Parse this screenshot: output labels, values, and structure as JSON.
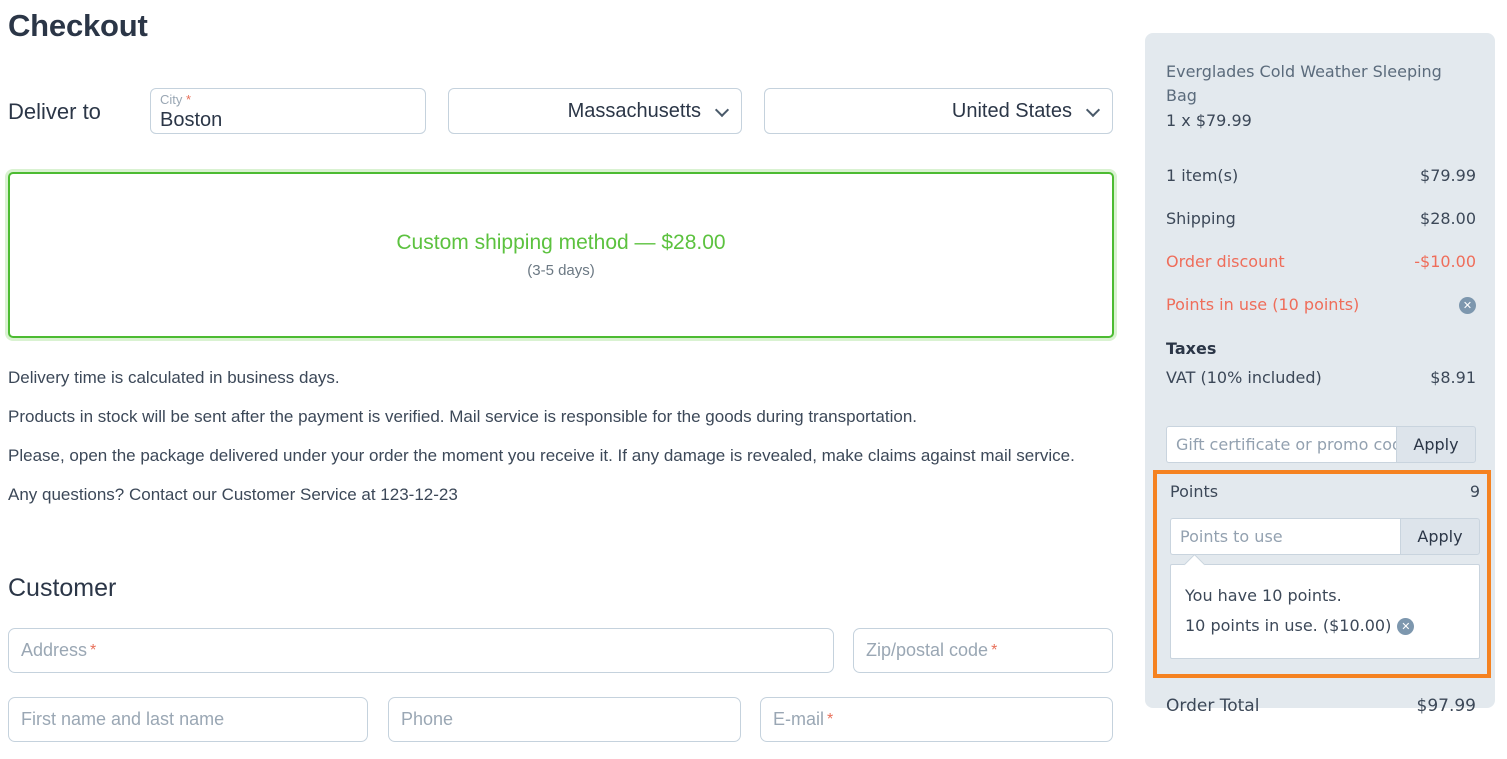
{
  "page": {
    "title": "Checkout"
  },
  "deliver": {
    "label": "Deliver to",
    "city": {
      "label": "City",
      "required_mark": "*",
      "value": "Boston"
    },
    "state": {
      "selected": "Massachusetts"
    },
    "country": {
      "selected": "United States"
    }
  },
  "shipping_method": {
    "title": "Custom shipping method — $28.00",
    "subtitle": "(3-5 days)",
    "selected_color": "#4cbb32"
  },
  "info": {
    "paragraphs": [
      "Delivery time is calculated in business days.",
      "Products in stock will be sent after the payment is verified. Mail service is responsible for the goods during transportation.",
      "Please, open the package delivered under your order the moment you receive it. If any damage is revealed, make claims against mail service.",
      "Any questions? Contact our Customer Service at 123-12-23"
    ]
  },
  "customer": {
    "heading": "Customer",
    "fields": {
      "address": {
        "placeholder": "Address",
        "required_mark": "*",
        "value": ""
      },
      "zip": {
        "placeholder": "Zip/postal code",
        "required_mark": "*",
        "value": ""
      },
      "name": {
        "placeholder": "First name and last name",
        "required_mark": "",
        "value": ""
      },
      "phone": {
        "placeholder": "Phone",
        "required_mark": "",
        "value": ""
      },
      "email": {
        "placeholder": "E-mail",
        "required_mark": "*",
        "value": ""
      }
    }
  },
  "summary": {
    "product": {
      "name": "Everglades Cold Weather Sleeping Bag",
      "quantity_price": "1 x $79.99"
    },
    "rows": [
      {
        "label": "1 item(s)",
        "value": "$79.99"
      },
      {
        "label": "Shipping",
        "value": "$28.00"
      },
      {
        "label": "Order discount",
        "value": "-$10.00"
      },
      {
        "label": "Points in use (10 points)",
        "value": ""
      }
    ],
    "taxes_heading": "Taxes",
    "vat": {
      "label": "VAT (10% included)",
      "value": "$8.91"
    },
    "promo": {
      "placeholder": "Gift certificate or promo code",
      "apply_label": "Apply",
      "value": ""
    },
    "points": {
      "label": "Points",
      "count": "9",
      "input_placeholder": "Points to use",
      "apply_label": "Apply",
      "note_available": "You have 10 points.",
      "note_in_use": "10 points in use. ($10.00)"
    },
    "order_total": {
      "label": "Order Total",
      "value": "$97.99"
    },
    "accent_color": "#ef6d5a",
    "highlight_color": "#f58220",
    "remove_icon": "close-circle-icon"
  }
}
